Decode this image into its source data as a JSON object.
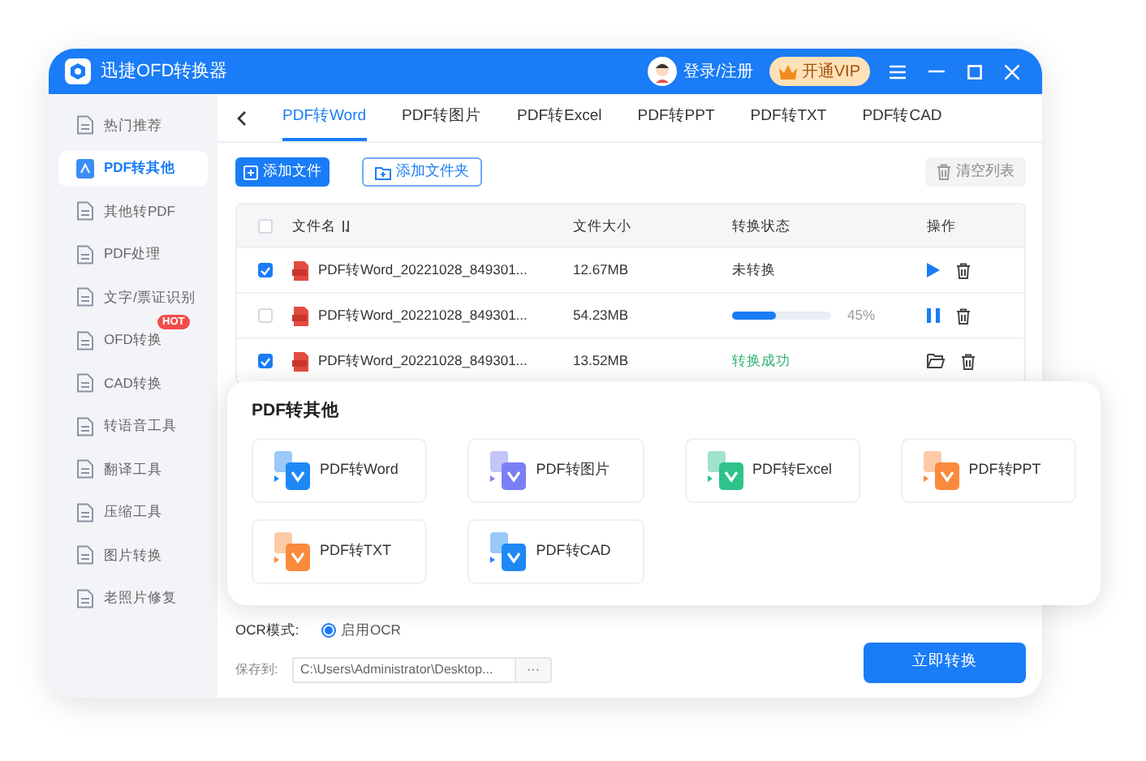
{
  "window": {
    "title": "迅捷OFD转换器",
    "login": "登录/注册",
    "vip": "开通VIP"
  },
  "sidebar": {
    "items": [
      {
        "label": "热门推荐",
        "selected": false
      },
      {
        "label": "PDF转其他",
        "selected": true
      },
      {
        "label": "其他转PDF",
        "selected": false
      },
      {
        "label": "PDF处理",
        "selected": false
      },
      {
        "label": "文字/票证识别",
        "selected": false
      },
      {
        "label": "OFD转换",
        "selected": false,
        "badge": "HOT"
      },
      {
        "label": "CAD转换",
        "selected": false
      },
      {
        "label": "转语音工具",
        "selected": false
      },
      {
        "label": "翻译工具",
        "selected": false
      },
      {
        "label": "压缩工具",
        "selected": false
      },
      {
        "label": "图片转换",
        "selected": false
      },
      {
        "label": "老照片修复",
        "selected": false
      }
    ]
  },
  "tabs": [
    {
      "label": "PDF转Word",
      "selected": true
    },
    {
      "label": "PDF转图片",
      "selected": false
    },
    {
      "label": "PDF转Excel",
      "selected": false
    },
    {
      "label": "PDF转PPT",
      "selected": false
    },
    {
      "label": "PDF转TXT",
      "selected": false
    },
    {
      "label": "PDF转CAD",
      "selected": false
    }
  ],
  "toolbar": {
    "add_file": "添加文件",
    "add_folder": "添加文件夹",
    "clear": "清空列表"
  },
  "table": {
    "header_checked": false,
    "columns": [
      "文件名",
      "文件大小",
      "转换状态",
      "操作"
    ],
    "rows": [
      {
        "checked": true,
        "name": "PDF转Word_20221028_849301...",
        "size": "12.67MB",
        "status": {
          "kind": "pending",
          "text": "未转换"
        }
      },
      {
        "checked": false,
        "name": "PDF转Word_20221028_849301...",
        "size": "54.23MB",
        "status": {
          "kind": "progress",
          "level": 0.45,
          "text": "45%"
        }
      },
      {
        "checked": true,
        "name": "PDF转Word_20221028_849301...",
        "size": "13.52MB",
        "status": {
          "kind": "done",
          "text": "转换成功"
        }
      }
    ]
  },
  "popup": {
    "title": "PDF转其他",
    "items": [
      {
        "label": "PDF转Word",
        "color": "#1e88f5"
      },
      {
        "label": "PDF转图片",
        "color": "#7b7ff5"
      },
      {
        "label": "PDF转Excel",
        "color": "#2fc28a"
      },
      {
        "label": "PDF转PPT",
        "color": "#fa8a3c"
      },
      {
        "label": "PDF转TXT",
        "color": "#fa8a3c"
      },
      {
        "label": "PDF转CAD",
        "color": "#1e88f5"
      }
    ]
  },
  "ocr": {
    "label": "OCR模式:",
    "option": "启用OCR",
    "selected": true
  },
  "save": {
    "label": "保存到:",
    "path": "C:\\Users\\Administrator\\Desktop...",
    "browse": "···"
  },
  "convert": "立即转换"
}
